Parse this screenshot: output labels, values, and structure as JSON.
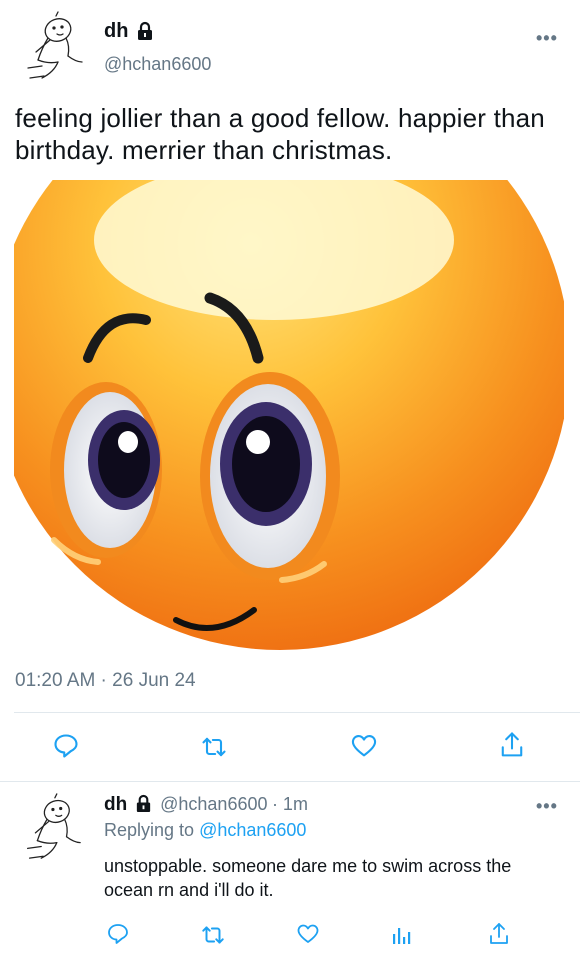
{
  "tweet": {
    "author_name": "dh",
    "author_handle": "@hchan6600",
    "text": "feeling jollier than a good fellow. happier than birthday. merrier than christmas.",
    "timestamp": "01:20 AM · 26 Jun 24",
    "more_label": "•••",
    "actions": [
      "reply-icon",
      "retweet-icon",
      "like-icon",
      "share-icon"
    ]
  },
  "reply": {
    "author_name": "dh",
    "author_handle": "@hchan6600",
    "time_ago": "· 1m",
    "replying_prefix": "Replying to",
    "replying_to": "@hchan6600",
    "text": "unstoppable. someone dare me to swim across the ocean rn and i'll do it.",
    "more_label": "•••",
    "actions": [
      "reply-icon",
      "retweet-icon",
      "like-icon",
      "analytics-icon",
      "share-icon"
    ]
  },
  "colors": {
    "accent": "#1da1f2",
    "muted": "#657786",
    "emoji_base": "#f7a12a"
  }
}
